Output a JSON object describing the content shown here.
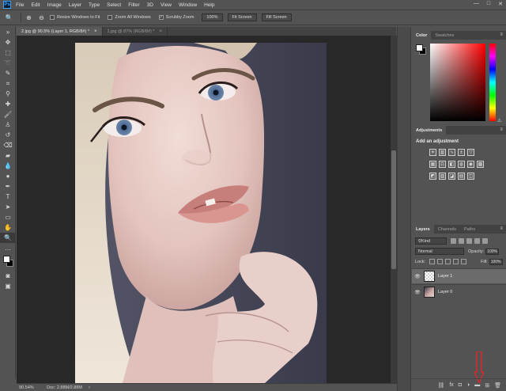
{
  "app": {
    "logo": "Ps"
  },
  "menu": [
    "File",
    "Edit",
    "Image",
    "Layer",
    "Type",
    "Select",
    "Filter",
    "3D",
    "View",
    "Window",
    "Help"
  ],
  "window_controls": {
    "minimize": "—",
    "maximize": "□",
    "close": "✕"
  },
  "options": {
    "resize_windows_label": "Resize Windows to Fit",
    "resize_windows_checked": false,
    "zoom_all_label": "Zoom All Windows",
    "zoom_all_checked": false,
    "scrubby_label": "Scrubby Zoom",
    "scrubby_checked": true,
    "btn_100": "100%",
    "btn_fit": "Fit Screen",
    "btn_fill": "Fill Screen"
  },
  "doc_tabs": [
    {
      "label": "2.jpg @ 90.5% (Layer 1, RGB/8#) *",
      "active": true
    },
    {
      "label": "1.jpg @ 87% (RGB/8#) *",
      "active": false
    }
  ],
  "tab_close": "×",
  "status": {
    "zoom": "90.54%",
    "doc_size": "Doc: 2.88M/2.88M",
    "arrow": "›"
  },
  "color_panel": {
    "tabs": [
      "Color",
      "Swatches"
    ],
    "warning": "⚠"
  },
  "adjustments": {
    "tab": "Adjustments",
    "title": "Add an adjustment"
  },
  "layers_panel": {
    "tabs": [
      "Layers",
      "Channels",
      "Paths"
    ],
    "kind_label": "Kind",
    "blend_mode": "Normal",
    "opacity_label": "Opacity:",
    "opacity_value": "100%",
    "lock_label": "Lock:",
    "fill_label": "Fill:",
    "fill_value": "100%",
    "layers": [
      {
        "name": "Layer 1",
        "selected": true,
        "thumb": "transparent"
      },
      {
        "name": "Layer 0",
        "selected": false,
        "thumb": "photo"
      }
    ],
    "footer_icons": [
      "link-icon",
      "fx-icon",
      "mask-icon",
      "adjustment-icon",
      "folder-icon",
      "new-layer-icon",
      "trash-icon"
    ]
  },
  "colors": {
    "accent": "#31a8ff",
    "annotation_arrow": "#e0262b",
    "ui_bg": "#535353",
    "canvas_bg": "#282828"
  }
}
